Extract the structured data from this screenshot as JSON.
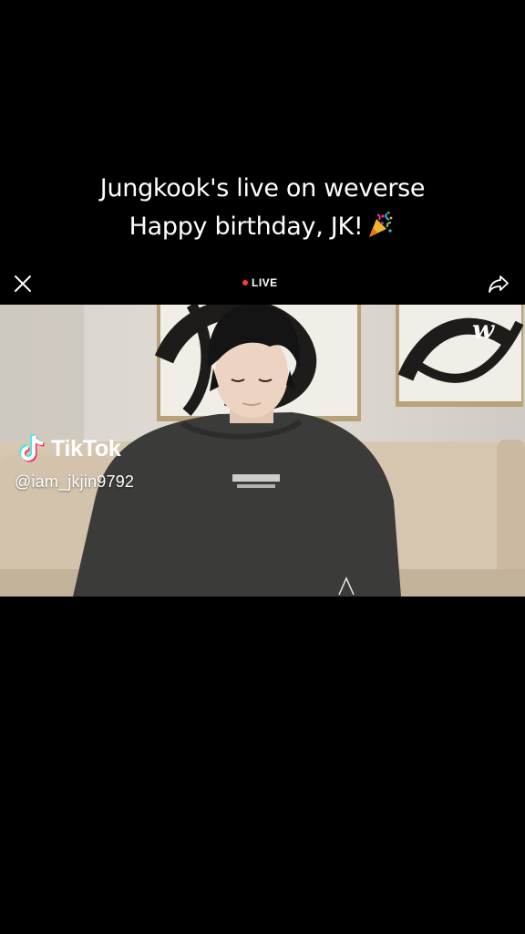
{
  "caption": {
    "line1": "Jungkook's live on weverse",
    "line2": "Happy birthday, JK!",
    "emoji_icon": "party-popper-icon"
  },
  "topbar": {
    "close_icon": "close-icon",
    "live_label": "LIVE",
    "share_icon": "share-icon"
  },
  "video": {
    "subject": "person in dark gray sweatshirt seated on beige sofa",
    "watermark_icon": "weverse-logo"
  },
  "watermark": {
    "brand": "TikTok",
    "handle": "@iam_jkjin9792"
  },
  "colors": {
    "background": "#000000",
    "live_dot": "#ff3b30",
    "tiktok_cyan": "#25f4ee",
    "tiktok_red": "#fe2c55"
  }
}
